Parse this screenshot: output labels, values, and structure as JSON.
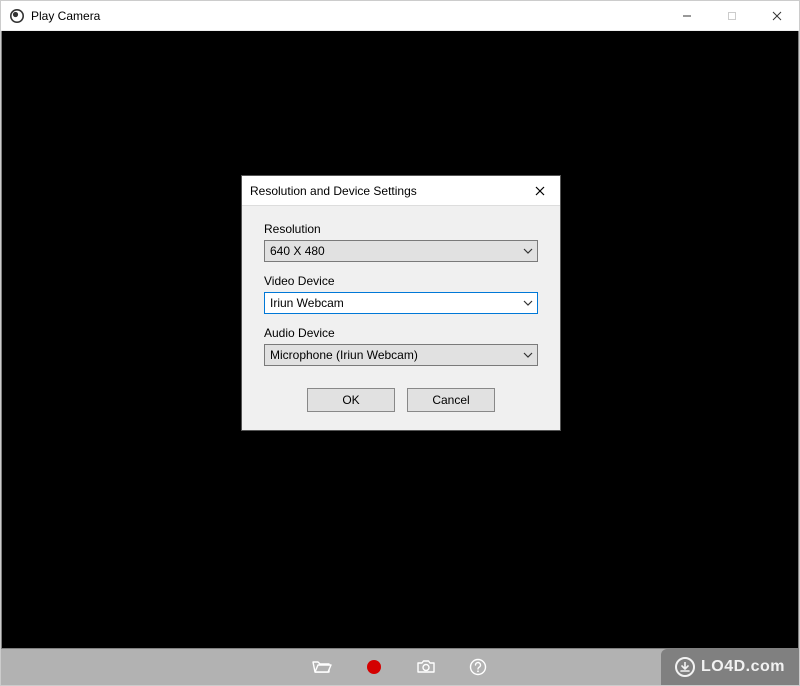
{
  "window": {
    "title": "Play Camera"
  },
  "dialog": {
    "title": "Resolution and Device Settings",
    "fields": {
      "resolution": {
        "label": "Resolution",
        "value": "640 X 480"
      },
      "video_device": {
        "label": "Video Device",
        "value": "Iriun Webcam"
      },
      "audio_device": {
        "label": "Audio Device",
        "value": "Microphone (Iriun Webcam)"
      }
    },
    "buttons": {
      "ok": "OK",
      "cancel": "Cancel"
    }
  },
  "watermark": "LO4D.com"
}
